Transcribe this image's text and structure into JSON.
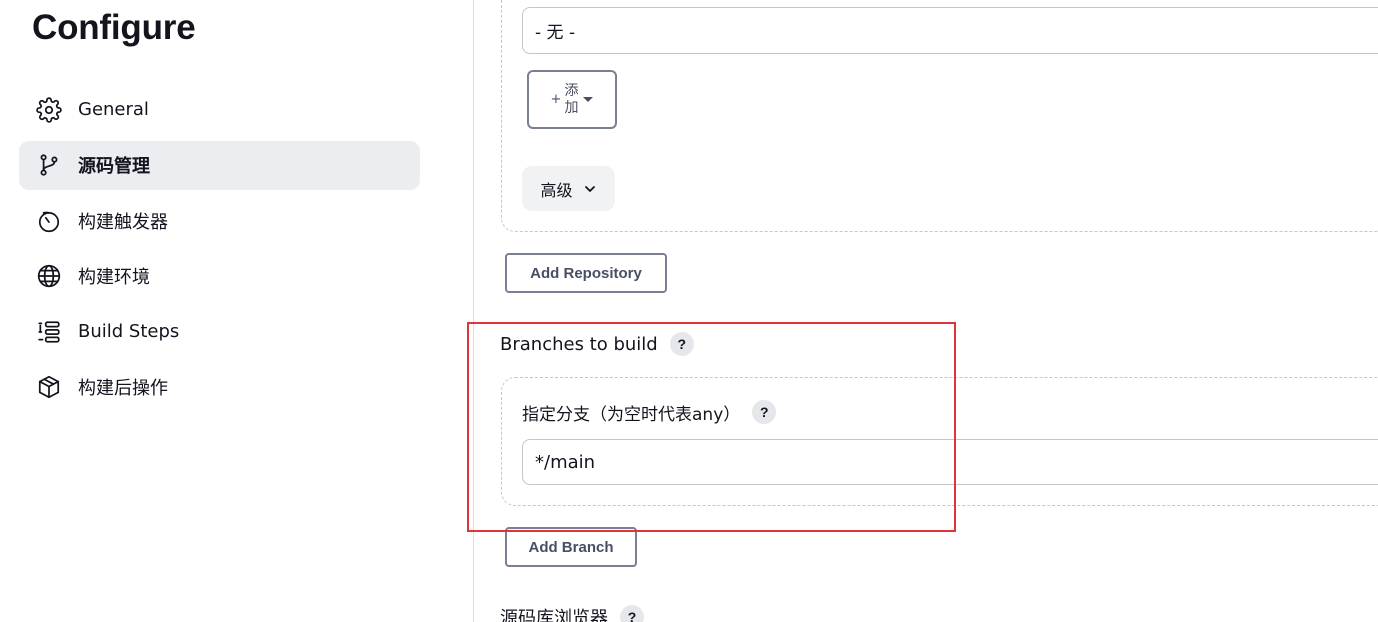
{
  "page": {
    "title": "Configure"
  },
  "sidebar": {
    "items": [
      {
        "label": "General",
        "icon": "gear-icon",
        "active": false
      },
      {
        "label": "源码管理",
        "icon": "git-branch-icon",
        "active": true
      },
      {
        "label": "构建触发器",
        "icon": "timer-icon",
        "active": false
      },
      {
        "label": "构建环境",
        "icon": "globe-icon",
        "active": false
      },
      {
        "label": "Build Steps",
        "icon": "list-steps-icon",
        "active": false
      },
      {
        "label": "构建后操作",
        "icon": "package-icon",
        "active": false
      }
    ]
  },
  "repository": {
    "credentials_value": "- 无 -",
    "add_button": {
      "plus": "+",
      "label": "添加"
    },
    "advanced_label": "高级",
    "add_repository_label": "Add Repository"
  },
  "branches": {
    "title": "Branches to build",
    "help": "?",
    "spec_label": "指定分支（为空时代表any）",
    "spec_help": "?",
    "spec_value": "*/main",
    "add_branch_label": "Add Branch"
  },
  "browser": {
    "label": "源码库浏览器",
    "help": "?"
  },
  "colors": {
    "highlight": "#e0343a",
    "active_nav_bg": "#ebedf1",
    "button_border": "#7b7f93"
  }
}
